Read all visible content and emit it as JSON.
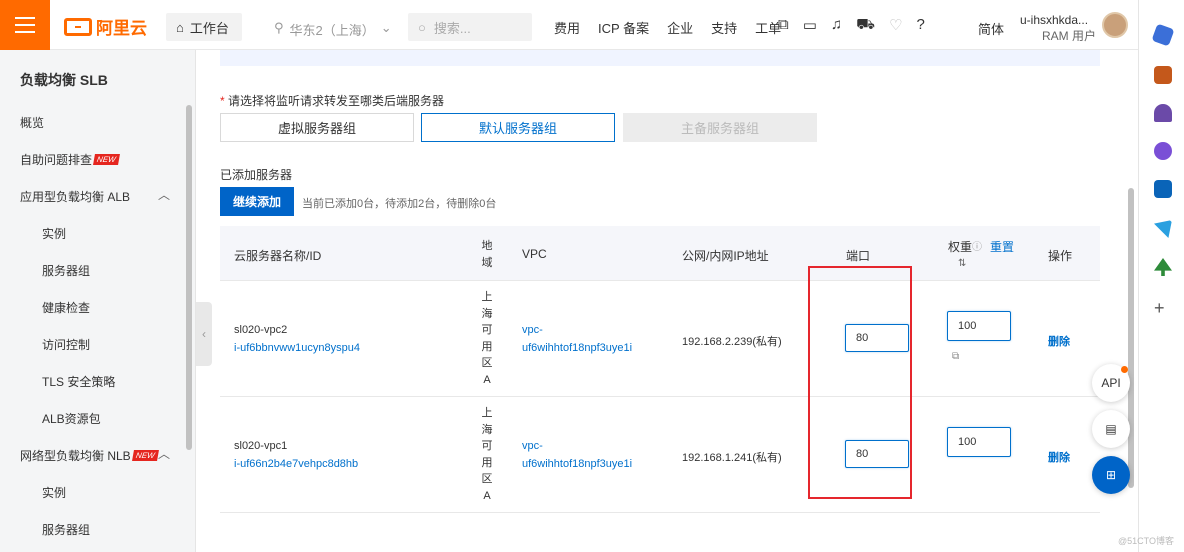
{
  "topbar": {
    "logo_text": "阿里云",
    "workbench_label": "工作台",
    "region_label": "华东2（上海）",
    "search_placeholder": "搜索...",
    "nav": [
      "费用",
      "ICP 备案",
      "企业",
      "支持",
      "工单"
    ],
    "lang_label": "简体",
    "user_name": "u-ihsxhkda...",
    "user_role": "RAM 用户"
  },
  "sidebar": {
    "title": "负载均衡 SLB",
    "items": [
      {
        "label": "概览"
      },
      {
        "label": "自助问题排查",
        "badge": "NEW"
      },
      {
        "label": "应用型负载均衡 ALB"
      },
      {
        "label": "实例"
      },
      {
        "label": "服务器组"
      },
      {
        "label": "健康检查"
      },
      {
        "label": "访问控制"
      },
      {
        "label": "TLS 安全策略"
      },
      {
        "label": "ALB资源包"
      },
      {
        "label": "网络型负载均衡 NLB",
        "badge": "NEW"
      },
      {
        "label": "实例"
      },
      {
        "label": "服务器组"
      }
    ]
  },
  "main": {
    "select_label": "请选择将监听请求转发至哪类后端服务器",
    "required_mark": "*",
    "segments": [
      "虚拟服务器组",
      "默认服务器组",
      "主备服务器组"
    ],
    "added_label": "已添加服务器",
    "continue_button": "继续添加",
    "count_text": "当前已添加0台，待添加2台，待删除0台",
    "table": {
      "headers": {
        "name": "云服务器名称/ID",
        "zone": "地域",
        "vpc": "VPC",
        "ip": "公网/内网IP地址",
        "port": "端口",
        "weight": "权重",
        "reset": "重置",
        "action": "操作"
      },
      "rows": [
        {
          "name": "sl020-vpc2",
          "id": "i-uf6bbnvww1ucyn8yspu4",
          "zone": "上海可用区A",
          "vpc1": "vpc-",
          "vpc2": "uf6wihhtof18npf3uye1i",
          "ip": "192.168.2.239(私有)",
          "port": "80",
          "weight": "100",
          "action": "删除"
        },
        {
          "name": "sl020-vpc1",
          "id": "i-uf66n2b4e7vehpc8d8hb",
          "zone": "上海可用区A",
          "vpc1": "vpc-",
          "vpc2": "uf6wihhtof18npf3uye1i",
          "ip": "192.168.1.241(私有)",
          "port": "80",
          "weight": "100",
          "action": "删除"
        }
      ]
    }
  },
  "floating": {
    "api_label": "API"
  },
  "watermark": "@51CTO博客",
  "colors": {
    "accent": "#ff6a00",
    "primary": "#0064c8",
    "link": "#0070cc",
    "highlight": "#e5262d"
  }
}
